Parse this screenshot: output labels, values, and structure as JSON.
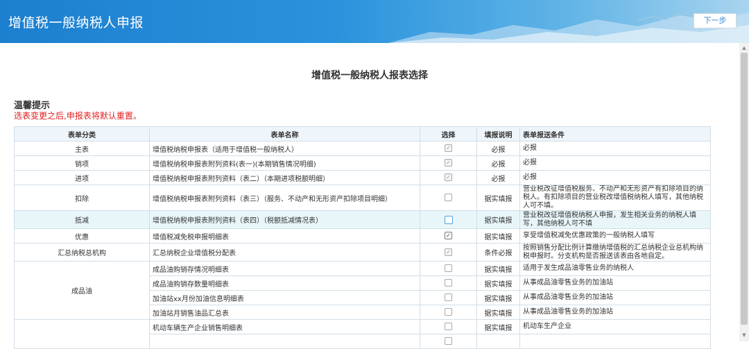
{
  "header": {
    "title": "增值税一般纳税人申报",
    "next_label": "下一步"
  },
  "page": {
    "title": "增值税一般纳税人报表选择",
    "tip_title": "温馨提示",
    "tip_text": "选表变更之后,申报表将默认重置。"
  },
  "table": {
    "headers": [
      "表单分类",
      "表单名称",
      "选择",
      "填报说明",
      "表单报送条件"
    ],
    "rows": [
      {
        "category": "主表",
        "name": "增值税纳税申报表（适用于增值税一般纳税人）",
        "check": "checked-disabled",
        "note": "必报",
        "condition": "必报"
      },
      {
        "category": "销项",
        "name": "增值税纳税申报表附列资料(表一)(本期销售情况明细)",
        "check": "checked-disabled",
        "note": "必报",
        "condition": "必报"
      },
      {
        "category": "进项",
        "name": "增值税纳税申报表附列资料（表二）（本期进项税额明细）",
        "check": "checked-disabled",
        "note": "必报",
        "condition": "必报"
      },
      {
        "category": "扣除",
        "name": "增值税纳税申报表附列资料（表三）（服务、不动产和无形资产扣除项目明细）",
        "check": "unchecked",
        "note": "据实填报",
        "condition": "营业税改征增值税服务、不动产和无形资产有扣除项目的纳税人。有扣除项目的营业税改增值税纳税人填写，其他纳税人可不填。"
      },
      {
        "category": "抵减",
        "name": "增值税纳税申报表附列资料（表四）（税额抵减情况表）",
        "check": "focus",
        "note": "据实填报",
        "condition": "营业税改征增值税纳税人申报，发生相关业务的纳税人填写，其他纳税人可不填"
      },
      {
        "category": "优惠",
        "name": "增值税减免税申报明细表",
        "check": "checked",
        "note": "据实填报",
        "condition": "享受增值税减免优惠政策的一般纳税人填写"
      },
      {
        "category": "汇总纳税总机构",
        "name": "汇总纳税企业增值税分配表",
        "check": "checked-disabled",
        "note": "条件必报",
        "condition": "按照销售分配比例计算缴纳增值税的汇总纳税企业总机构纳税申报时。分支机构是否报送该表由各地自定。"
      },
      {
        "category": "成品油",
        "name": "成品油购销存情况明细表",
        "check": "unchecked",
        "note": "据实填报",
        "condition": "适用于发生成品油零售业务的纳税人"
      },
      {
        "category": "",
        "name": "成品油购销存数量明细表",
        "check": "unchecked",
        "note": "据实填报",
        "condition": "从事成品油零售业务的加油站"
      },
      {
        "category": "",
        "name": "加油站xx月份加油信息明细表",
        "check": "unchecked",
        "note": "据实填报",
        "condition": "从事成品油零售业务的加油站"
      },
      {
        "category": "",
        "name": "加油站月销售油品汇总表",
        "check": "unchecked",
        "note": "据实填报",
        "condition": "从事成品油零售业务的加油站"
      },
      {
        "category": "",
        "name": "机动车辆生产企业销售明细表",
        "check": "unchecked",
        "note": "据实填报",
        "condition": "机动车生产企业"
      }
    ]
  },
  "colors": {
    "header_blue": "#1d7fcf",
    "tip_red": "#e02020",
    "table_border": "#d2dde6",
    "highlight_row": "#e8f6f9"
  }
}
